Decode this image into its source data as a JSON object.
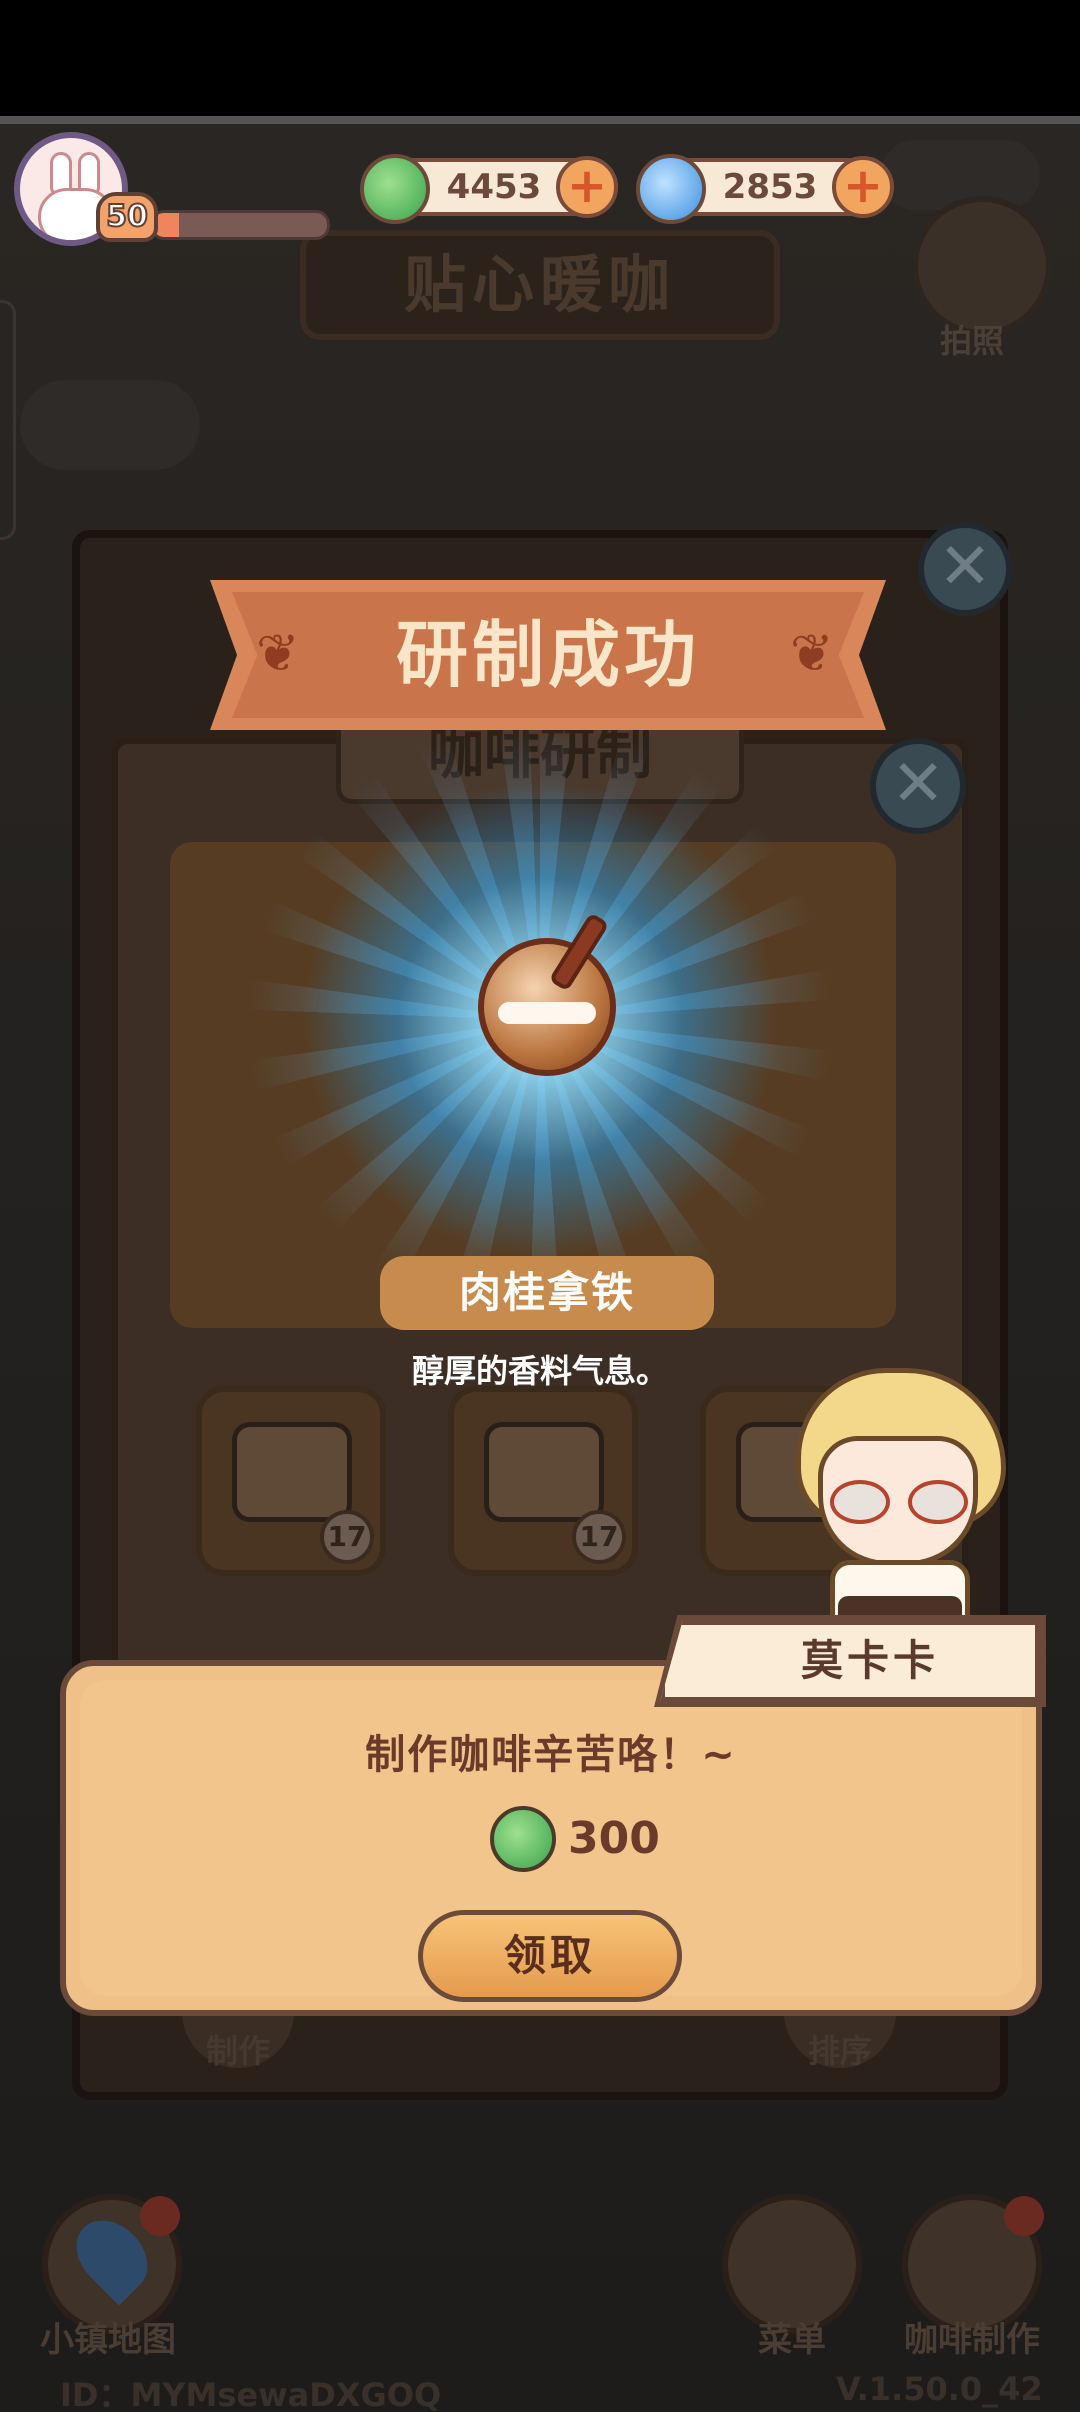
{
  "hud": {
    "level": "50",
    "xp_progress": 0.15,
    "leaf_currency": "4453",
    "swirl_currency": "2853",
    "plus": "+"
  },
  "background": {
    "shop_title": "贴心暖咖",
    "camera_label": "拍照"
  },
  "result_panel": {
    "banner_title": "研制成功",
    "sub_title": "咖啡研制",
    "close_glyph": "✕",
    "item_name": "肉桂拿铁",
    "item_description": "醇厚的香料气息。",
    "ingredients": [
      {
        "icon": "coffee-cups-icon",
        "count": "17"
      },
      {
        "icon": "sugar-packet-icon",
        "count": "17"
      },
      {
        "icon": "milk-jug-icon",
        "count": ""
      }
    ],
    "dim_make_label": "制作",
    "dim_sort_label": "排序"
  },
  "dialog": {
    "speaker": "莫卡卡",
    "message": "制作咖啡辛苦咯！~",
    "reward_amount": "300",
    "claim_button": "领取"
  },
  "bottom_nav": {
    "map_label": "小镇地图",
    "menu_label": "菜单",
    "coffee_label": "咖啡制作"
  },
  "footer": {
    "player_id": "ID：MYMsewaDXGOQ",
    "version": "V.1.50.0_42"
  },
  "colors": {
    "banner": "#d9875a",
    "dialog_bg": "#f2c58c",
    "claim_button": "#e59a4e"
  }
}
